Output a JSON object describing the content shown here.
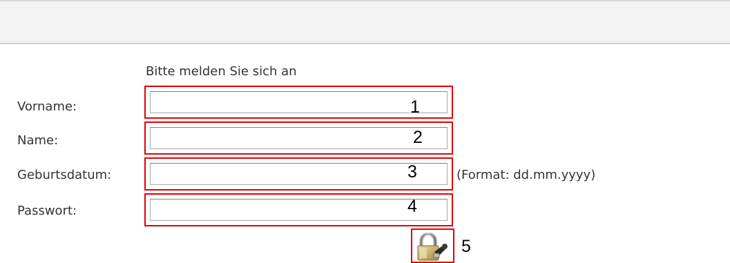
{
  "form": {
    "heading": "Bitte melden Sie sich an",
    "fields": [
      {
        "label": "Vorname:",
        "value": "",
        "marker": "1"
      },
      {
        "label": "Name:",
        "value": "",
        "marker": "2"
      },
      {
        "label": "Geburtsdatum:",
        "value": "",
        "marker": "3",
        "hint": "(Format: dd.mm.yyyy)"
      },
      {
        "label": "Passwort:",
        "value": "",
        "marker": "4"
      }
    ],
    "login": {
      "icon": "padlock-key-icon",
      "marker": "5"
    }
  },
  "colors": {
    "highlight_border": "#e10000",
    "top_band": "#f3f3f3",
    "text": "#333333"
  }
}
